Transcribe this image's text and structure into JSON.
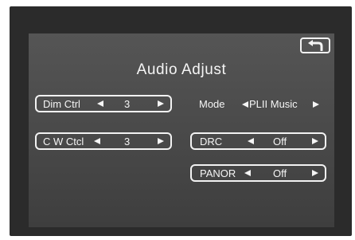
{
  "screen": {
    "title": "Audio Adjust",
    "back_icon": "return-arrow-icon"
  },
  "controls": {
    "dim_ctrl": {
      "label": "Dim Ctrl",
      "value": "3"
    },
    "cw_ctrl": {
      "label": "C W Ctcl",
      "value": "3"
    },
    "mode": {
      "label": "Mode",
      "value": "PLII Music"
    },
    "drc": {
      "label": "DRC",
      "value": "Off"
    },
    "panor": {
      "label": "PANOR",
      "value": "Off"
    }
  },
  "colors": {
    "bezel": "#2b2b2b",
    "screen": "#4c4c4c",
    "foreground": "#f5f5f5"
  }
}
